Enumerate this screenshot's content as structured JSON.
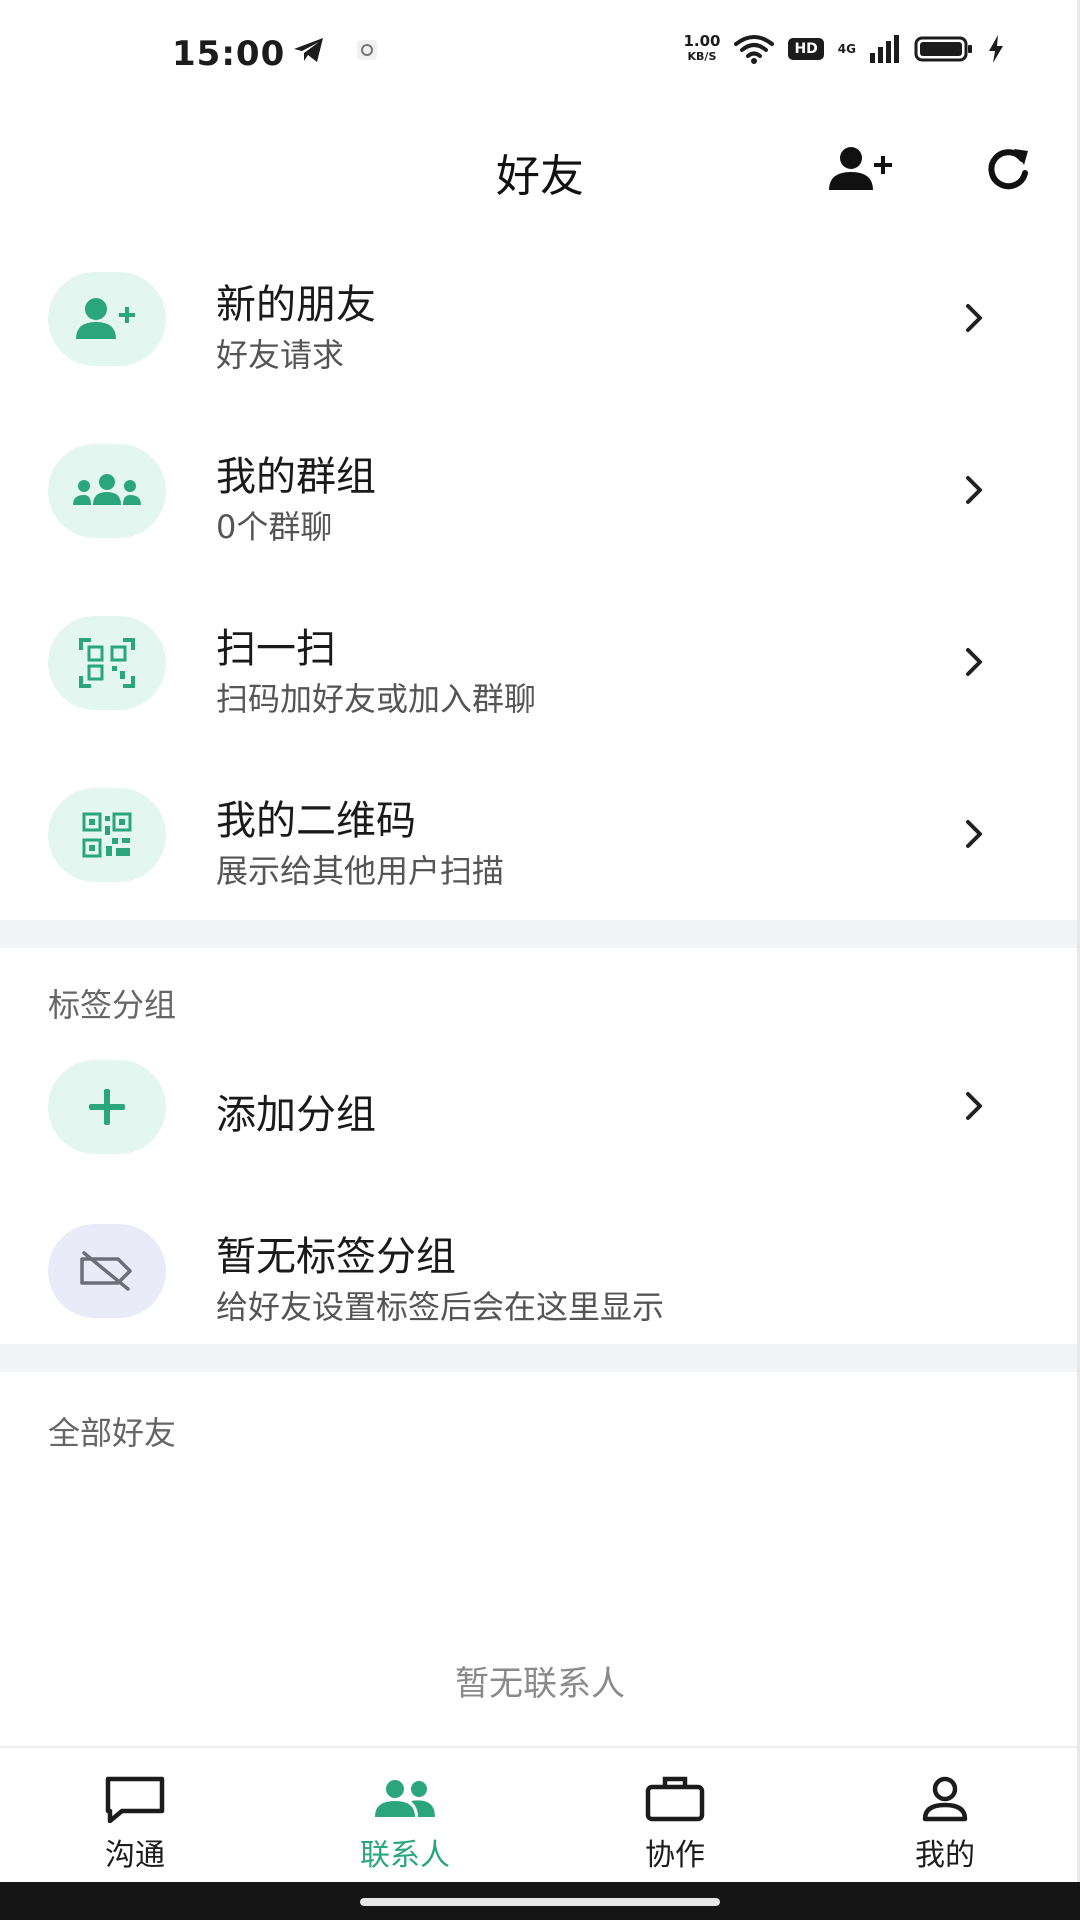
{
  "status_bar": {
    "time": "15:00",
    "net_speed_value": "1.00",
    "net_speed_unit": "KB/S",
    "hd_label": "HD",
    "network_label": "4G"
  },
  "header": {
    "title": "好友"
  },
  "menu": {
    "new_friends": {
      "title": "新的朋友",
      "subtitle": "好友请求"
    },
    "my_groups": {
      "title": "我的群组",
      "subtitle": "0个群聊"
    },
    "scan": {
      "title": "扫一扫",
      "subtitle": "扫码加好友或加入群聊"
    },
    "my_qrcode": {
      "title": "我的二维码",
      "subtitle": "展示给其他用户扫描"
    }
  },
  "tag_groups": {
    "section_label": "标签分组",
    "add_group": {
      "title": "添加分组"
    },
    "empty": {
      "title": "暂无标签分组",
      "subtitle": "给好友设置标签后会在这里显示"
    }
  },
  "all_friends": {
    "section_label": "全部好友",
    "empty_text": "暂无联系人"
  },
  "tabbar": {
    "tabs": [
      {
        "label": "沟通",
        "icon": "chat-icon"
      },
      {
        "label": "联系人",
        "icon": "contacts-icon"
      },
      {
        "label": "协作",
        "icon": "briefcase-icon"
      },
      {
        "label": "我的",
        "icon": "user-icon"
      }
    ],
    "active_index": 1
  },
  "colors": {
    "accent": "#2aa57c",
    "icon_bg": "#e3f6ef",
    "icon_bg_gray": "#e9ecf8",
    "divider": "#f2f5f8"
  }
}
